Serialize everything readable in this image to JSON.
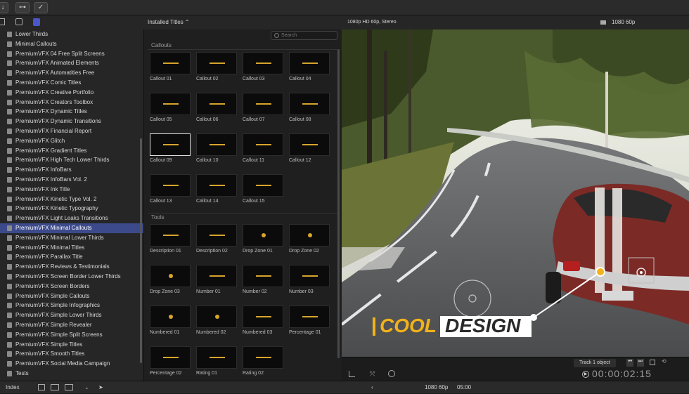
{
  "sidebar": {
    "items": [
      "Lower Thirds",
      "Minimal Callouts",
      "PremiumVFX 04 Free Split Screens",
      "PremiumVFX Animated Elements",
      "PremiumVFX Automatities Free",
      "PremiumVFX Comic Titles",
      "PremiumVFX Creative Portfolio",
      "PremiumVFX Creators Toolbox",
      "PremiumVFX Dynamic Titles",
      "PremiumVFX Dynamic Transitions",
      "PremiumVFX Financial Report",
      "PremiumVFX Glitch",
      "PremiumVFX Gradient Titles",
      "PremiumVFX High Tech Lower Thirds",
      "PremiumVFX InfoBars",
      "PremiumVFX InfoBars Vol. 2",
      "PremiumVFX Ink Title",
      "PremiumVFX Kinetic Type Vol. 2",
      "PremiumVFX Kinetic Typography",
      "PremiumVFX Light Leaks Transitions",
      "PremiumVFX Minimal Callouts",
      "PremiumVFX Minimal Lower Thirds",
      "PremiumVFX Minimal Titles",
      "PremiumVFX Parallax Title",
      "PremiumVFX Reviews & Testimonials",
      "PremiumVFX Screen Border Lower Thirds",
      "PremiumVFX Screen Borders",
      "PremiumVFX Simple Callouts",
      "PremiumVFX Simple Infographics",
      "PremiumVFX Simple Lower Thirds",
      "PremiumVFX Simple Revealer",
      "PremiumVFX Simple Split Screens",
      "PremiumVFX Simple Titles",
      "PremiumVFX Smooth Titles",
      "PremiumVFX Social Media Campaign",
      "Tests"
    ],
    "selected_index": 20
  },
  "browser": {
    "dropdown_label": "Installed Titles ⌃",
    "search_placeholder": "Search",
    "sections": {
      "callouts_title": "Callouts",
      "tools_title": "Tools"
    },
    "callouts": [
      "Callout 01",
      "Callout 02",
      "Callout 03",
      "Callout 04",
      "Callout 05",
      "Callout 06",
      "Callout 07",
      "Callout 08",
      "Callout 09",
      "Callout 10",
      "Callout 11",
      "Callout 12",
      "Callout 13",
      "Callout 14",
      "Callout 15"
    ],
    "tools": [
      "Description 01",
      "Description 02",
      "Drop Zone 01",
      "Drop Zone 02",
      "Drop Zone 03",
      "Number 01",
      "Number 02",
      "Number 03",
      "Numbered 01",
      "Numbered 02",
      "Numbered 03",
      "Percentage 01",
      "Percentage 02",
      "Rating 01",
      "Rating 02"
    ],
    "selected_callout_index": 8
  },
  "viewer": {
    "format_label": "1080p HD 60p, Stereo",
    "resolution_label": "1080 60p",
    "overlay_word1": "COOL",
    "overlay_word2": "DESIGN",
    "track_label": "Track 1 object",
    "timecode": "00:00:02:15"
  },
  "bottom": {
    "index_label": "Index",
    "format": "1080 60p",
    "duration": "05:00"
  },
  "colors": {
    "accent": "#3c4a8c",
    "callout_yellow": "#f2b21a"
  }
}
